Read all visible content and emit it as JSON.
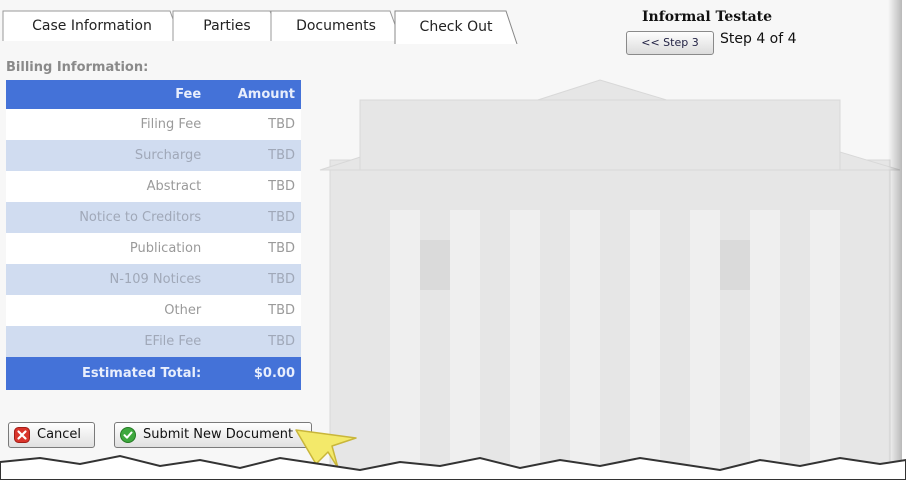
{
  "tabs": [
    {
      "label": "Case Information"
    },
    {
      "label": "Parties"
    },
    {
      "label": "Documents"
    },
    {
      "label": "Check Out",
      "active": true
    }
  ],
  "header": {
    "title": "Informal Testate",
    "step_back_label": "<< Step 3",
    "step_text": "Step 4 of 4"
  },
  "billing": {
    "label": "Billing Information:",
    "columns": [
      "Fee",
      "Amount"
    ],
    "rows": [
      {
        "fee": "Filing Fee",
        "amount": "TBD"
      },
      {
        "fee": "Surcharge",
        "amount": "TBD"
      },
      {
        "fee": "Abstract",
        "amount": "TBD"
      },
      {
        "fee": "Notice to Creditors",
        "amount": "TBD"
      },
      {
        "fee": "Publication",
        "amount": "TBD"
      },
      {
        "fee": "N-109 Notices",
        "amount": "TBD"
      },
      {
        "fee": "Other",
        "amount": "TBD"
      },
      {
        "fee": "EFile Fee",
        "amount": "TBD"
      }
    ],
    "total_label": "Estimated Total:",
    "total_amount": "$0.00"
  },
  "actions": {
    "cancel_label": "Cancel",
    "submit_label": "Submit New Document"
  },
  "colors": {
    "table_header": "#4472d8",
    "row_alt": "#d0dcf0",
    "cancel_icon": "#d9342b",
    "submit_icon": "#3ea83e",
    "pointer": "#f3e96a"
  },
  "icons": [
    "cancel-x-icon",
    "check-circle-icon",
    "callout-pointer-icon"
  ]
}
